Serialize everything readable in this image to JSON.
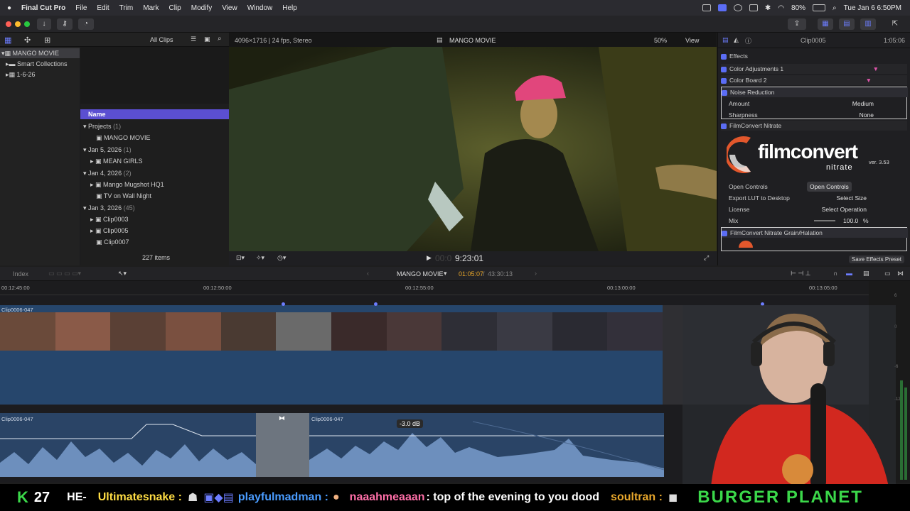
{
  "menubar": {
    "app": "Final Cut Pro",
    "items": [
      "File",
      "Edit",
      "Trim",
      "Mark",
      "Clip",
      "Modify",
      "View",
      "Window",
      "Help"
    ],
    "battery": "80%",
    "datetime": "Tue Jan 6  6:50PM"
  },
  "browser": {
    "filter": "All Clips",
    "library": "MANGO MOVIE",
    "library_items": [
      "Smart Collections",
      "1-6-26"
    ],
    "column_name": "Name",
    "groups": [
      {
        "label": "Projects",
        "count": "(1)",
        "items": [
          "MANGO MOVIE"
        ]
      },
      {
        "label": "Jan 5, 2026",
        "count": "(1)",
        "items": [
          "MEAN GIRLS"
        ]
      },
      {
        "label": "Jan 4, 2026",
        "count": "(2)",
        "items": [
          "Mango Mugshot HQ1",
          "TV on Wall Night"
        ]
      },
      {
        "label": "Jan 3, 2026",
        "count": "(45)",
        "items": [
          "Clip0003",
          "Clip0005",
          "Clip0007"
        ]
      }
    ],
    "item_count": "227 items"
  },
  "viewer": {
    "format": "4096×1716 | 24 fps, Stereo",
    "title": "MANGO MOVIE",
    "zoom": "50%",
    "view_menu": "View",
    "timecode": "9:23:01",
    "timecode_prefix": "00:0"
  },
  "inspector": {
    "clip": "Clip0005",
    "duration": "1:05:06",
    "effects_header": "Effects",
    "effects": [
      "Color Adjustments 1",
      "Color Board 2"
    ],
    "noise_reduction": {
      "title": "Noise Reduction",
      "amount_label": "Amount",
      "amount": "Medium",
      "sharpness_label": "Sharpness",
      "sharpness": "None"
    },
    "filmconvert": {
      "title": "FilmConvert Nitrate",
      "logo_word": "filmconvert",
      "logo_sub": "nitrate",
      "version": "ver. 3.53",
      "open_controls_label": "Open Controls",
      "open_controls_button": "Open Controls",
      "export_label": "Export LUT to Desktop",
      "export_value": "Select Size",
      "license_label": "License",
      "license_value": "Select Operation",
      "mix_label": "Mix",
      "mix_value": "100.0",
      "mix_unit": "%"
    },
    "grain": "FilmConvert Nitrate Grain/Halation",
    "save_preset": "Save Effects Preset"
  },
  "timeline": {
    "index": "Index",
    "project": "MANGO MOVIE",
    "position": "01:05:07",
    "total": "43:30:13",
    "ruler": [
      "00:12:45:00",
      "00:12:50:00",
      "00:12:55:00",
      "00:13:00:00",
      "00:13:05:00"
    ],
    "video_clip": "Clip0006-047",
    "audio_clip_left": "Clip0006-047",
    "audio_clip_right": "Clip0006-047",
    "volume_tooltip": "-3.0 dB",
    "meter_ticks": [
      "6",
      "0",
      "-6",
      "-12"
    ]
  },
  "chat": {
    "counter_letter": "K",
    "counter": "27",
    "msg1_user": "HE-",
    "msg2_user": "Ultimatesnake :",
    "msg3_user": "playfulmadman :",
    "msg4_user": "naaahmeaaan",
    "msg4_text": ": top of the evening to you dood",
    "msg5_user": "soultran :",
    "banner": "BURGER PLANET"
  }
}
